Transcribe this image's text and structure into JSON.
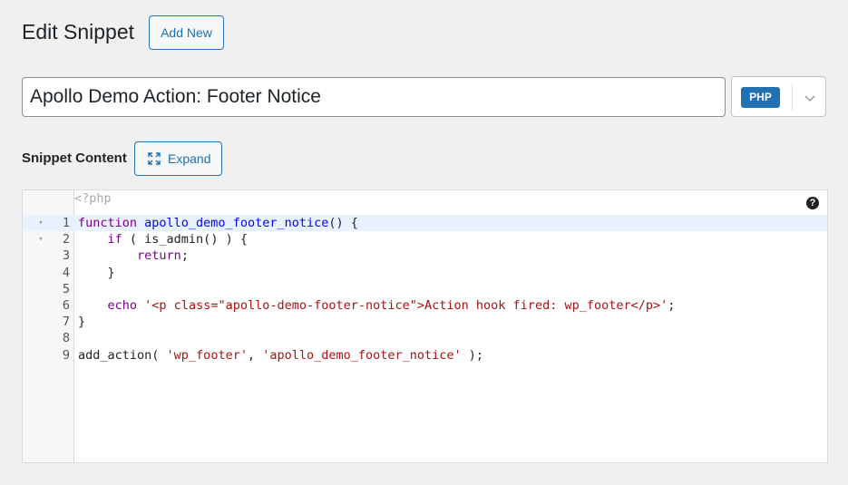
{
  "header": {
    "title": "Edit Snippet",
    "add_new_label": "Add New"
  },
  "snippet": {
    "title_value": "Apollo Demo Action: Footer Notice",
    "language_badge": "PHP"
  },
  "content_section": {
    "label": "Snippet Content",
    "expand_label": "Expand"
  },
  "editor": {
    "placeholder": "<?php",
    "help_glyph": "?",
    "lines": [
      {
        "number": "1",
        "fold": "▾",
        "active": true,
        "tokens": [
          {
            "t": "kw",
            "v": "function "
          },
          {
            "t": "def",
            "v": "apollo_demo_footer_notice"
          },
          {
            "t": "plain",
            "v": "() {"
          }
        ]
      },
      {
        "number": "2",
        "fold": "▾",
        "active": false,
        "tokens": [
          {
            "t": "plain",
            "v": "    "
          },
          {
            "t": "kw",
            "v": "if"
          },
          {
            "t": "plain",
            "v": " ( is_admin() ) {"
          }
        ]
      },
      {
        "number": "3",
        "fold": "",
        "active": false,
        "tokens": [
          {
            "t": "plain",
            "v": "        "
          },
          {
            "t": "kw",
            "v": "return"
          },
          {
            "t": "plain",
            "v": ";"
          }
        ]
      },
      {
        "number": "4",
        "fold": "",
        "active": false,
        "tokens": [
          {
            "t": "plain",
            "v": "    }"
          }
        ]
      },
      {
        "number": "5",
        "fold": "",
        "active": false,
        "tokens": []
      },
      {
        "number": "6",
        "fold": "",
        "active": false,
        "tokens": [
          {
            "t": "plain",
            "v": "    "
          },
          {
            "t": "kw",
            "v": "echo"
          },
          {
            "t": "plain",
            "v": " "
          },
          {
            "t": "str",
            "v": "'<p class=\"apollo-demo-footer-notice\">Action hook fired: wp_footer</p>'"
          },
          {
            "t": "plain",
            "v": ";"
          }
        ]
      },
      {
        "number": "7",
        "fold": "",
        "active": false,
        "tokens": [
          {
            "t": "plain",
            "v": "}"
          }
        ]
      },
      {
        "number": "8",
        "fold": "",
        "active": false,
        "tokens": []
      },
      {
        "number": "9",
        "fold": "",
        "active": false,
        "tokens": [
          {
            "t": "plain",
            "v": "add_action( "
          },
          {
            "t": "str",
            "v": "'wp_footer'"
          },
          {
            "t": "plain",
            "v": ", "
          },
          {
            "t": "str",
            "v": "'apollo_demo_footer_notice'"
          },
          {
            "t": "plain",
            "v": " );"
          }
        ]
      }
    ]
  },
  "colors": {
    "accent": "#2271b1",
    "keyword": "#770088",
    "definition": "#0000ff",
    "string": "#aa1111",
    "active_line": "#e8f2ff"
  },
  "icons": {
    "expand": "expand-arrows-icon",
    "language_dropdown": "chevron-down-icon",
    "help": "help-circle-icon"
  }
}
